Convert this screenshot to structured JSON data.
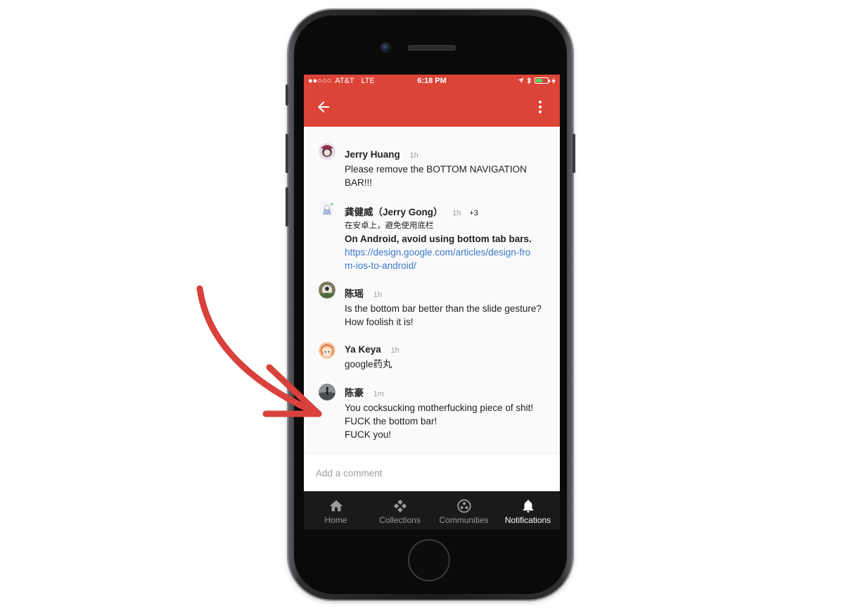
{
  "status_bar": {
    "signal": "●●○○○",
    "carrier": "AT&T",
    "network": "LTE",
    "time": "6:18 PM"
  },
  "colors": {
    "app_bar": "#db4437",
    "link": "#3b78c9",
    "bottom_nav": "#1a1a1a",
    "annotation_arrow": "#d9413c"
  },
  "app_bar": {
    "back_icon": "arrow-left-icon",
    "more_icon": "more-vertical-icon"
  },
  "comments": [
    {
      "name": "Jerry Huang",
      "time": "1h",
      "text": "Please remove the BOTTOM NAVIGATION BAR!!!"
    },
    {
      "name": "龚健威（Jerry Gong）",
      "time": "1h",
      "plus": "+3",
      "line_cn": "在安卓上，避免使用底栏",
      "line_bold": "On Android, avoid using bottom tab bars.",
      "link": "https://design.google.com/articles/design-from-ios-to-android/"
    },
    {
      "name": "陈瑶",
      "time": "1h",
      "text": "Is the bottom bar better than the slide gesture? How foolish it is!"
    },
    {
      "name": "Ya Keya",
      "time": "1h",
      "text": "google药丸"
    },
    {
      "name": "陈豪",
      "time": "1m",
      "lines": [
        "You cocksucking motherfucking piece of shit!",
        "FUCK the bottom bar!",
        "FUCK you!"
      ]
    }
  ],
  "add_comment": {
    "placeholder": "Add a comment"
  },
  "bottom_nav": {
    "items": [
      {
        "label": "Home",
        "icon": "home-icon"
      },
      {
        "label": "Collections",
        "icon": "collections-icon"
      },
      {
        "label": "Communities",
        "icon": "communities-icon"
      },
      {
        "label": "Notifications",
        "icon": "bell-icon",
        "active": true
      }
    ]
  }
}
